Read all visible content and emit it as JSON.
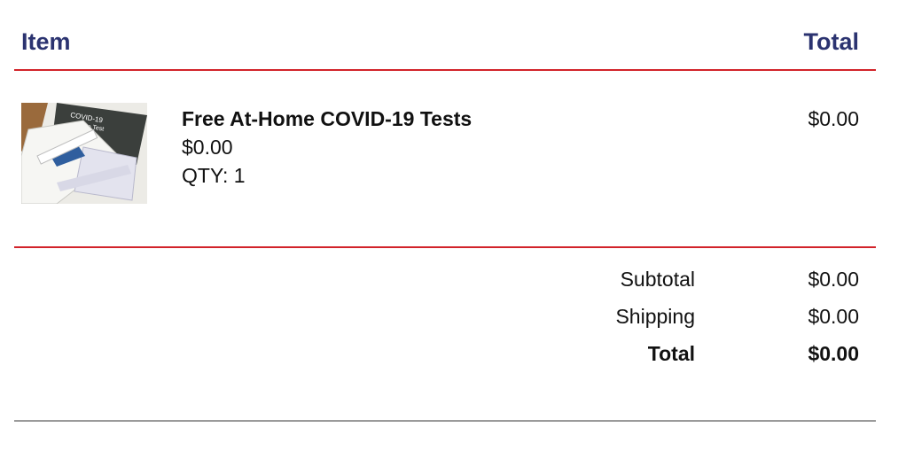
{
  "header": {
    "item_label": "Item",
    "total_label": "Total"
  },
  "line_item": {
    "image_icon": "covid-test-kit-image",
    "name": "Free At-Home COVID-19 Tests",
    "price": "$0.00",
    "qty": "QTY: 1",
    "total": "$0.00"
  },
  "summary": {
    "subtotal_label": "Subtotal",
    "subtotal_value": "$0.00",
    "shipping_label": "Shipping",
    "shipping_value": "$0.00",
    "total_label": "Total",
    "total_value": "$0.00"
  },
  "colors": {
    "heading": "#2b3370",
    "rule_red": "#d2232a",
    "rule_gray": "#9b9b9b"
  }
}
